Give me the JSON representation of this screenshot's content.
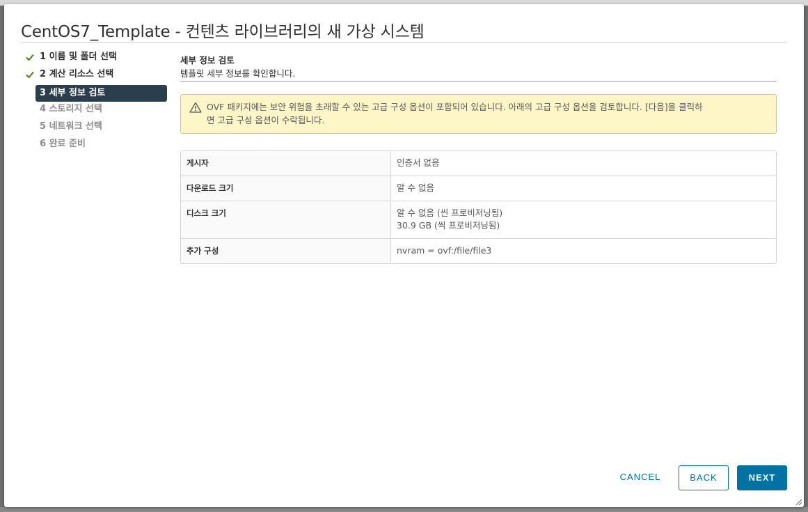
{
  "modal": {
    "title": "CentOS7_Template - 컨텐츠 라이브러리의 새 가상 시스템"
  },
  "steps": [
    {
      "label": "1 이름 및 폴더 선택",
      "state": "done"
    },
    {
      "label": "2 계산 리소스 선택",
      "state": "done"
    },
    {
      "label": "3 세부 정보 검토",
      "state": "active"
    },
    {
      "label": "4 스토리지 선택",
      "state": "todo"
    },
    {
      "label": "5 네트워크 선택",
      "state": "todo"
    },
    {
      "label": "6 완료 준비",
      "state": "todo"
    }
  ],
  "main": {
    "section_title": "세부 정보 검토",
    "section_subtitle": "템플릿 세부 정보를 확인합니다.",
    "alert": {
      "icon": "warning-icon",
      "line1": "OVF 패키지에는 보안 위험을 초래할 수 있는 고급 구성 옵션이 포함되어 있습니다. 아래의 고급 구성 옵션을 검토합니다. [다음]을 클릭하",
      "line2": "면 고급 구성 옵션이 수락됩니다."
    },
    "details": [
      {
        "key": "게시자",
        "values": [
          "인증서 없음"
        ]
      },
      {
        "key": "다운로드 크기",
        "values": [
          "알 수 없음"
        ]
      },
      {
        "key": "디스크 크기",
        "values": [
          "알 수 없음 (씬 프로비저닝됨)",
          "30.9 GB (씩 프로비저닝됨)"
        ]
      },
      {
        "key": "추가 구성",
        "values": [
          "nvram = ovf:/file/file3"
        ]
      }
    ]
  },
  "footer": {
    "cancel_label": "CANCEL",
    "back_label": "BACK",
    "next_label": "NEXT"
  },
  "colors": {
    "accent": "#0072a3",
    "active_step_bg": "#2b3e4e",
    "check_green": "#3c8500",
    "alert_bg": "#fff6c8",
    "alert_border": "#e8c25a"
  }
}
